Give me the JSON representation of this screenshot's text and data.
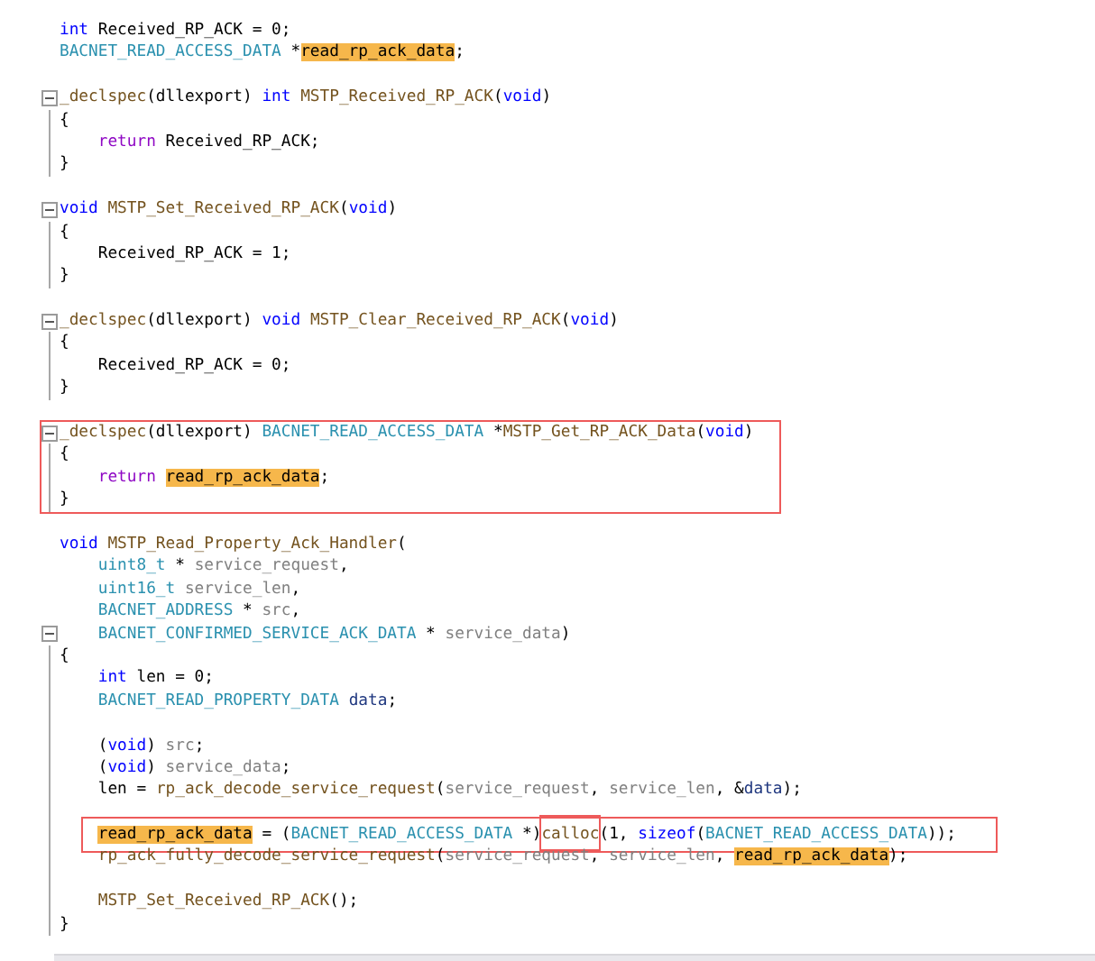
{
  "sections": [
    {
      "outlined": false,
      "lines": [
        {
          "foldable": false,
          "guide": false,
          "tokens": [
            {
              "text": "int",
              "kind": "keyword"
            },
            {
              "text": " Received_RP_ACK = 0;",
              "kind": "plain"
            }
          ]
        },
        {
          "foldable": false,
          "guide": false,
          "tokens": [
            {
              "text": "BACNET_READ_ACCESS_DATA",
              "kind": "type"
            },
            {
              "text": " *",
              "kind": "plain"
            },
            {
              "text": "read_rp_ack_data",
              "kind": "highlight"
            },
            {
              "text": ";",
              "kind": "plain"
            }
          ]
        },
        {
          "foldable": false,
          "guide": false
        },
        {
          "foldable": true,
          "guide": false,
          "tokens": [
            {
              "text": "_declspec",
              "kind": "function"
            },
            {
              "text": "(dllexport) ",
              "kind": "plain"
            },
            {
              "text": "int ",
              "kind": "keyword"
            },
            {
              "text": "MSTP_Received_RP_ACK",
              "kind": "function"
            },
            {
              "text": "(",
              "kind": "plain"
            },
            {
              "text": "void",
              "kind": "keyword"
            },
            {
              "text": ")",
              "kind": "plain"
            }
          ]
        },
        {
          "foldable": false,
          "guide": true,
          "tokens": [
            {
              "text": "{",
              "kind": "plain"
            }
          ]
        },
        {
          "foldable": false,
          "guide": true,
          "tokens": [
            {
              "text": "    return",
              "kind": "control"
            },
            {
              "text": " Received_RP_ACK;",
              "kind": "plain"
            }
          ]
        },
        {
          "foldable": false,
          "guide": true,
          "tokens": [
            {
              "text": "}",
              "kind": "plain"
            }
          ]
        },
        {
          "foldable": false,
          "guide": false
        },
        {
          "foldable": true,
          "guide": false,
          "tokens": [
            {
              "text": "void ",
              "kind": "keyword"
            },
            {
              "text": "MSTP_Set_Received_RP_ACK",
              "kind": "function"
            },
            {
              "text": "(",
              "kind": "plain"
            },
            {
              "text": "void",
              "kind": "keyword"
            },
            {
              "text": ")",
              "kind": "plain"
            }
          ]
        },
        {
          "foldable": false,
          "guide": true,
          "tokens": [
            {
              "text": "{",
              "kind": "plain"
            }
          ]
        },
        {
          "foldable": false,
          "guide": true,
          "tokens": [
            {
              "text": "    Received_RP_ACK = 1;",
              "kind": "plain"
            }
          ]
        },
        {
          "foldable": false,
          "guide": true,
          "tokens": [
            {
              "text": "}",
              "kind": "plain"
            }
          ]
        },
        {
          "foldable": false,
          "guide": false
        },
        {
          "foldable": true,
          "guide": false,
          "tokens": [
            {
              "text": "_declspec",
              "kind": "function"
            },
            {
              "text": "(dllexport) ",
              "kind": "plain"
            },
            {
              "text": "void ",
              "kind": "keyword"
            },
            {
              "text": "MSTP_Clear_Received_RP_ACK",
              "kind": "function"
            },
            {
              "text": "(",
              "kind": "plain"
            },
            {
              "text": "void",
              "kind": "keyword"
            },
            {
              "text": ")",
              "kind": "plain"
            }
          ]
        },
        {
          "foldable": false,
          "guide": true,
          "tokens": [
            {
              "text": "{",
              "kind": "plain"
            }
          ]
        },
        {
          "foldable": false,
          "guide": true,
          "tokens": [
            {
              "text": "    Received_RP_ACK = 0;",
              "kind": "plain"
            }
          ]
        },
        {
          "foldable": false,
          "guide": true,
          "tokens": [
            {
              "text": "}",
              "kind": "plain"
            }
          ]
        },
        {
          "foldable": false,
          "guide": false
        }
      ]
    },
    {
      "outlined": true,
      "lines": [
        {
          "foldable": true,
          "guide": false,
          "tokens": [
            {
              "text": "_declspec",
              "kind": "function"
            },
            {
              "text": "(dllexport) ",
              "kind": "plain"
            },
            {
              "text": "BACNET_READ_ACCESS_DATA",
              "kind": "type"
            },
            {
              "text": " *",
              "kind": "plain"
            },
            {
              "text": "MSTP_Get_RP_ACK_Data",
              "kind": "function"
            },
            {
              "text": "(",
              "kind": "plain"
            },
            {
              "text": "void",
              "kind": "keyword"
            },
            {
              "text": ")",
              "kind": "plain"
            }
          ]
        },
        {
          "foldable": false,
          "guide": true,
          "tokens": [
            {
              "text": "{",
              "kind": "plain"
            }
          ]
        },
        {
          "foldable": false,
          "guide": true,
          "tokens": [
            {
              "text": "    return ",
              "kind": "control"
            },
            {
              "text": "read_rp_ack_data",
              "kind": "highlight"
            },
            {
              "text": ";",
              "kind": "plain"
            }
          ]
        },
        {
          "foldable": false,
          "guide": true,
          "tokens": [
            {
              "text": "}",
              "kind": "plain"
            }
          ]
        }
      ]
    },
    {
      "outlined": false,
      "lines": [
        {
          "foldable": false,
          "guide": false
        },
        {
          "foldable": false,
          "guide": false,
          "tokens": [
            {
              "text": "void ",
              "kind": "keyword"
            },
            {
              "text": "MSTP_Read_Property_Ack_Handler",
              "kind": "function"
            },
            {
              "text": "(",
              "kind": "plain"
            }
          ]
        },
        {
          "foldable": false,
          "guide": false,
          "tokens": [
            {
              "text": "    uint8_t",
              "kind": "type"
            },
            {
              "text": " * ",
              "kind": "plain"
            },
            {
              "text": "service_request",
              "kind": "param"
            },
            {
              "text": ",",
              "kind": "plain"
            }
          ]
        },
        {
          "foldable": false,
          "guide": false,
          "tokens": [
            {
              "text": "    uint16_t ",
              "kind": "type"
            },
            {
              "text": "service_len",
              "kind": "param"
            },
            {
              "text": ",",
              "kind": "plain"
            }
          ]
        },
        {
          "foldable": false,
          "guide": false,
          "tokens": [
            {
              "text": "    BACNET_ADDRESS",
              "kind": "type"
            },
            {
              "text": " * ",
              "kind": "plain"
            },
            {
              "text": "src",
              "kind": "param"
            },
            {
              "text": ",",
              "kind": "plain"
            }
          ]
        },
        {
          "foldable": true,
          "guide": false,
          "tokens": [
            {
              "text": "    BACNET_CONFIRMED_SERVICE_ACK_DATA",
              "kind": "type"
            },
            {
              "text": " * ",
              "kind": "plain"
            },
            {
              "text": "service_data",
              "kind": "param"
            },
            {
              "text": ")",
              "kind": "plain"
            }
          ]
        },
        {
          "foldable": false,
          "guide": true,
          "tokens": [
            {
              "text": "{",
              "kind": "plain"
            }
          ]
        },
        {
          "foldable": false,
          "guide": true,
          "tokens": [
            {
              "text": "    int",
              "kind": "keyword"
            },
            {
              "text": " len = 0;",
              "kind": "plain"
            }
          ]
        },
        {
          "foldable": false,
          "guide": true,
          "tokens": [
            {
              "text": "    BACNET_READ_PROPERTY_DATA ",
              "kind": "type"
            },
            {
              "text": "data",
              "kind": "local"
            },
            {
              "text": ";",
              "kind": "plain"
            }
          ]
        },
        {
          "foldable": false,
          "guide": true
        },
        {
          "foldable": false,
          "guide": true,
          "tokens": [
            {
              "text": "    (",
              "kind": "plain"
            },
            {
              "text": "void",
              "kind": "keyword"
            },
            {
              "text": ") ",
              "kind": "plain"
            },
            {
              "text": "src",
              "kind": "param"
            },
            {
              "text": ";",
              "kind": "plain"
            }
          ]
        },
        {
          "foldable": false,
          "guide": true,
          "tokens": [
            {
              "text": "    (",
              "kind": "plain"
            },
            {
              "text": "void",
              "kind": "keyword"
            },
            {
              "text": ") ",
              "kind": "plain"
            },
            {
              "text": "service_data",
              "kind": "param"
            },
            {
              "text": ";",
              "kind": "plain"
            }
          ]
        },
        {
          "foldable": false,
          "guide": true,
          "tokens": [
            {
              "text": "    len = ",
              "kind": "plain"
            },
            {
              "text": "rp_ack_decode_service_request",
              "kind": "function"
            },
            {
              "text": "(",
              "kind": "plain"
            },
            {
              "text": "service_request",
              "kind": "param"
            },
            {
              "text": ", ",
              "kind": "plain"
            },
            {
              "text": "service_len",
              "kind": "param"
            },
            {
              "text": ", &",
              "kind": "plain"
            },
            {
              "text": "data",
              "kind": "local"
            },
            {
              "text": ");",
              "kind": "plain"
            }
          ]
        },
        {
          "foldable": false,
          "guide": true
        },
        {
          "foldable": false,
          "guide": true,
          "outlined": true,
          "tokens": [
            {
              "text": "    read_rp_ack_data",
              "kind": "highlight"
            },
            {
              "text": " = (",
              "kind": "plain"
            },
            {
              "text": "BACNET_READ_ACCESS_DATA",
              "kind": "type"
            },
            {
              "text": " *)",
              "kind": "plain"
            },
            {
              "text": "calloc",
              "kind": "function",
              "outlined": true
            },
            {
              "text": "(1, ",
              "kind": "plain"
            },
            {
              "text": "sizeof",
              "kind": "keyword"
            },
            {
              "text": "(",
              "kind": "plain"
            },
            {
              "text": "BACNET_READ_ACCESS_DATA",
              "kind": "type"
            },
            {
              "text": "));",
              "kind": "plain"
            }
          ]
        },
        {
          "foldable": false,
          "guide": true,
          "tokens": [
            {
              "text": "    rp_ack_fully_decode_service_request",
              "kind": "function"
            },
            {
              "text": "(",
              "kind": "plain"
            },
            {
              "text": "service_request",
              "kind": "param"
            },
            {
              "text": ", ",
              "kind": "plain"
            },
            {
              "text": "service_len",
              "kind": "param"
            },
            {
              "text": ", ",
              "kind": "plain"
            },
            {
              "text": "read_rp_ack_data",
              "kind": "highlight"
            },
            {
              "text": ");",
              "kind": "plain"
            }
          ]
        },
        {
          "foldable": false,
          "guide": true
        },
        {
          "foldable": false,
          "guide": true,
          "tokens": [
            {
              "text": "    MSTP_Set_Received_RP_ACK",
              "kind": "function"
            },
            {
              "text": "();",
              "kind": "plain"
            }
          ]
        },
        {
          "foldable": false,
          "guide": true,
          "tokens": [
            {
              "text": "}",
              "kind": "plain"
            }
          ]
        }
      ]
    }
  ]
}
